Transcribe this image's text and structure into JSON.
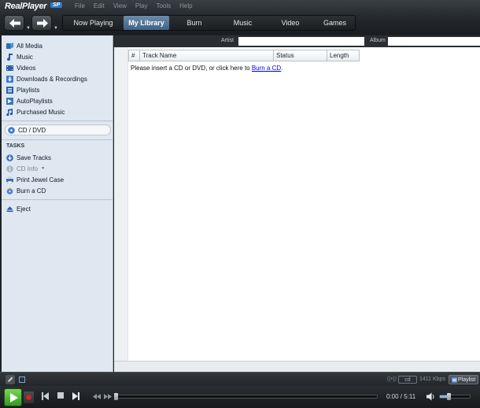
{
  "app": {
    "logo": "RealPlayer",
    "logo_badge": "SP"
  },
  "menu": [
    "File",
    "Edit",
    "View",
    "Play",
    "Tools",
    "Help"
  ],
  "tabs": [
    {
      "label": "Now Playing",
      "active": false
    },
    {
      "label": "My Library",
      "active": true
    },
    {
      "label": "Burn",
      "active": false
    },
    {
      "label": "Music",
      "active": false
    },
    {
      "label": "Video",
      "active": false
    },
    {
      "label": "Games",
      "active": false
    }
  ],
  "sidebar": {
    "library": [
      {
        "label": "All Media",
        "icon": "all-media-icon"
      },
      {
        "label": "Music",
        "icon": "music-note-icon"
      },
      {
        "label": "Videos",
        "icon": "film-icon"
      },
      {
        "label": "Downloads & Recordings",
        "icon": "download-icon"
      },
      {
        "label": "Playlists",
        "icon": "playlist-icon"
      },
      {
        "label": "AutoPlaylists",
        "icon": "autoplaylist-icon"
      },
      {
        "label": "Purchased Music",
        "icon": "purchased-music-icon"
      }
    ],
    "device": {
      "label": "CD / DVD",
      "icon": "cd-icon"
    },
    "tasks_heading": "TASKS",
    "tasks": [
      {
        "label": "Save Tracks",
        "icon": "save-tracks-icon",
        "enabled": true
      },
      {
        "label": "CD Info",
        "icon": "info-icon",
        "enabled": false
      },
      {
        "label": "Print Jewel Case",
        "icon": "printer-icon",
        "enabled": true
      },
      {
        "label": "Burn a CD",
        "icon": "burn-icon",
        "enabled": true
      }
    ],
    "eject": {
      "label": "Eject",
      "icon": "eject-icon"
    }
  },
  "search": {
    "artist_label": "Artist",
    "album_label": "Album",
    "artist_value": "",
    "album_value": ""
  },
  "table": {
    "columns": [
      "#",
      "Track Name",
      "Status",
      "Length"
    ],
    "empty_prefix": "Please insert a CD or DVD, or click here to ",
    "empty_link": "Burn a CD",
    "empty_suffix": "."
  },
  "status": {
    "source": "cd",
    "bitrate": "1411 Kbps",
    "playlist_label": "Playlist"
  },
  "transport": {
    "time": "0:00 / 5:11",
    "progress": 0.0,
    "volume": 0.3
  },
  "colors": {
    "accent": "#3f6386",
    "play": "#3aa524",
    "sidebar": "#dfe7f0",
    "link": "#0000ee"
  }
}
